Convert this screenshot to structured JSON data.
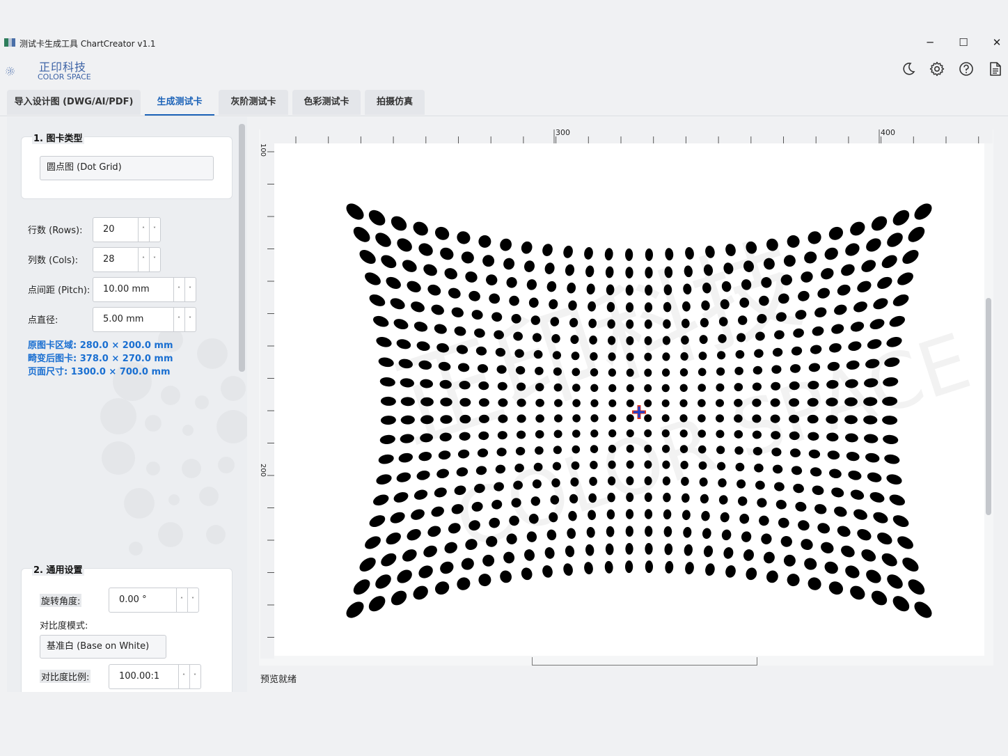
{
  "window": {
    "title": "测试卡生成工具 ChartCreator v1.1",
    "minimize": "─",
    "maximize": "☐",
    "close": "✕"
  },
  "logo": {
    "cn": "正印科技",
    "en": "COLOR SPACE"
  },
  "toolbar_icons": [
    "moon-icon",
    "gear-icon",
    "help-icon",
    "document-icon"
  ],
  "tabs": [
    {
      "label": "导入设计图 (DWG/AI/PDF)",
      "active": false
    },
    {
      "label": "生成测试卡",
      "active": true
    },
    {
      "label": "灰阶测试卡",
      "active": false
    },
    {
      "label": "色彩测试卡",
      "active": false
    },
    {
      "label": "拍摄仿真",
      "active": false
    }
  ],
  "section1": {
    "title": "1. 图卡类型",
    "chart_type": "圆点图 (Dot Grid)",
    "rows_label": "行数 (Rows):",
    "rows_value": "20",
    "cols_label": "列数 (Cols):",
    "cols_value": "28",
    "pitch_label": "点间距 (Pitch):",
    "pitch_value": "10.00 mm",
    "diameter_label": "点直径:",
    "diameter_value": "5.00 mm",
    "info_original": "原图卡区域: 280.0 × 200.0 mm",
    "info_distorted": "畸变后图卡: 378.0 × 270.0 mm",
    "info_page": "页面尺寸: 1300.0 × 700.0 mm"
  },
  "section2": {
    "title": "2. 通用设置",
    "rotation_label": "旋转角度:",
    "rotation_value": "0.00 °",
    "contrast_mode_label": "对比度模式:",
    "contrast_mode_value": "基准白 (Base on White)",
    "contrast_ratio_label": "对比度比例:",
    "contrast_ratio_value": "100.00:1"
  },
  "spin_arrows": {
    "up": "˄",
    "down": "˅"
  },
  "rulers": {
    "top_labels": [
      "300",
      "400"
    ],
    "left_labels": [
      "100",
      "200"
    ]
  },
  "preview": {
    "grid_rows": 20,
    "grid_cols": 28,
    "barrel_distortion": "pincushion"
  },
  "watermark": {
    "cn": "正印科技",
    "en": "COLOR SPACE"
  },
  "status": "预览就绪",
  "colors": {
    "accent": "#1c63b8",
    "info": "#1a6fd1",
    "dot": "#000000",
    "marker_blue": "#1a3fd0",
    "marker_red": "#e0301e"
  }
}
